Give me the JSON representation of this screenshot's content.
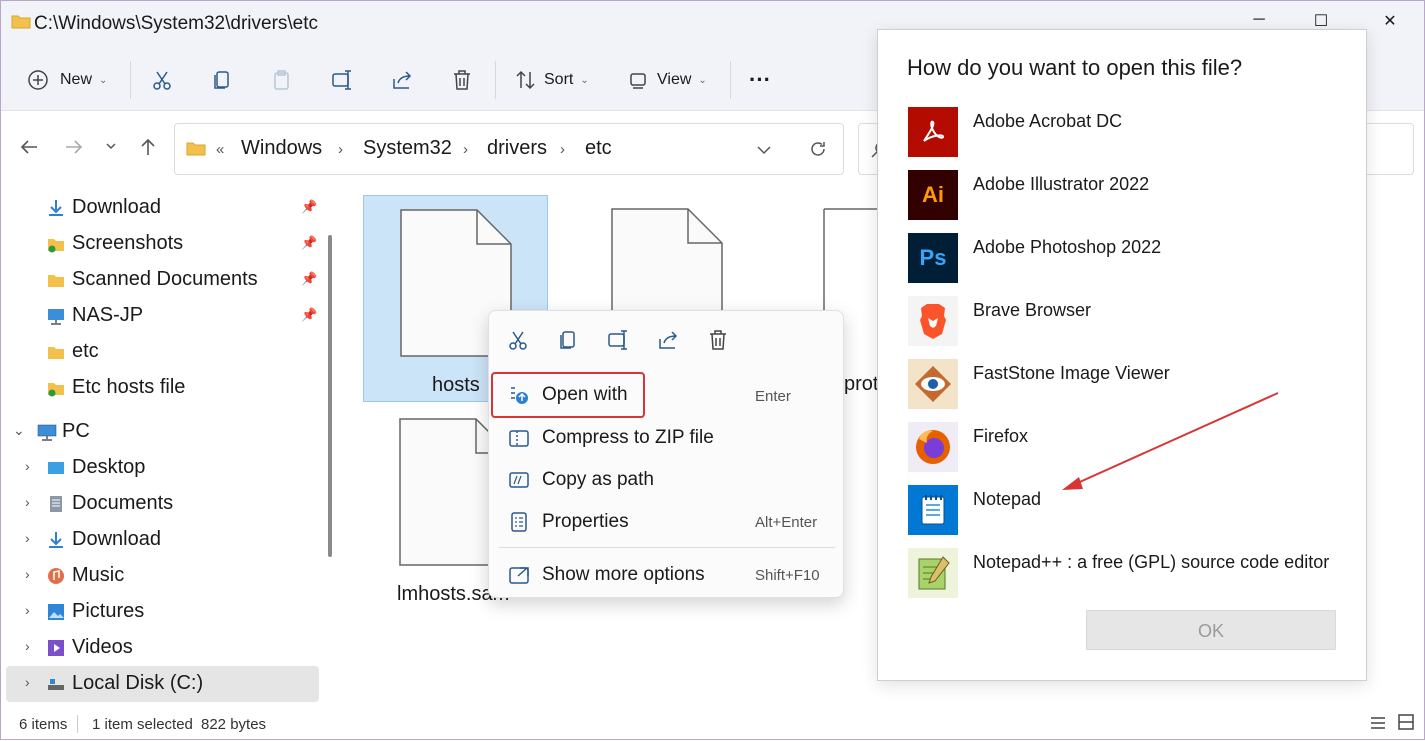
{
  "window": {
    "title": "C:\\Windows\\System32\\drivers\\etc",
    "minimize": "─",
    "maximize": "☐",
    "close": "✕"
  },
  "toolbar": {
    "new_label": "New",
    "sort_label": "Sort",
    "view_label": "View",
    "more_label": "···"
  },
  "breadcrumb": {
    "overflow": "«",
    "items": [
      "Windows",
      "System32",
      "drivers",
      "etc"
    ]
  },
  "sidebar": {
    "quick_access": [
      {
        "label": "Download",
        "icon": "download-icon"
      },
      {
        "label": "Screenshots",
        "icon": "folder-icon"
      },
      {
        "label": "Scanned Documents",
        "icon": "folder-icon"
      },
      {
        "label": "NAS-JP",
        "icon": "network-drive-icon"
      },
      {
        "label": "etc",
        "icon": "folder-icon"
      },
      {
        "label": "Etc hosts file",
        "icon": "folder-icon"
      }
    ],
    "pc_label": "PC",
    "pc_items": [
      {
        "label": "Desktop",
        "icon": "desktop-icon"
      },
      {
        "label": "Documents",
        "icon": "documents-icon"
      },
      {
        "label": "Download",
        "icon": "download-icon"
      },
      {
        "label": "Music",
        "icon": "music-icon"
      },
      {
        "label": "Pictures",
        "icon": "pictures-icon"
      },
      {
        "label": "Videos",
        "icon": "videos-icon"
      },
      {
        "label": "Local Disk (C:)",
        "icon": "drive-icon"
      }
    ]
  },
  "files": {
    "hosts": "hosts",
    "networks_partial": "prot",
    "lmhosts": "lmhosts.sam"
  },
  "context_menu": {
    "open_with": "Open with",
    "open_with_shortcut": "Enter",
    "compress": "Compress to ZIP file",
    "copy_path": "Copy as path",
    "properties": "Properties",
    "properties_shortcut": "Alt+Enter",
    "more_options": "Show more options",
    "more_options_shortcut": "Shift+F10"
  },
  "status": {
    "items": "6 items",
    "selected": "1 item selected",
    "size": "822 bytes"
  },
  "dialog": {
    "title": "How do you want to open this file?",
    "apps": [
      {
        "label": "Adobe Acrobat DC",
        "icon": "acrobat-icon",
        "color": "#b30b00"
      },
      {
        "label": "Adobe Illustrator 2022",
        "icon": "illustrator-icon",
        "color": "#330000"
      },
      {
        "label": "Adobe Photoshop 2022",
        "icon": "photoshop-icon",
        "color": "#001e36"
      },
      {
        "label": "Brave Browser",
        "icon": "brave-icon",
        "color": "#fb542b"
      },
      {
        "label": "FastStone Image Viewer",
        "icon": "faststone-icon",
        "color": "#c46a2f"
      },
      {
        "label": "Firefox",
        "icon": "firefox-icon",
        "color": "#e66000"
      },
      {
        "label": "Notepad",
        "icon": "notepad-icon",
        "color": "#0078d4"
      },
      {
        "label": "Notepad++ : a free (GPL) source code editor",
        "icon": "notepadpp-icon",
        "color": "#6b9e2e"
      }
    ],
    "ok_label": "OK"
  },
  "colors": {
    "accent_selection": "#cce4f7",
    "highlight_red": "#d83636"
  }
}
